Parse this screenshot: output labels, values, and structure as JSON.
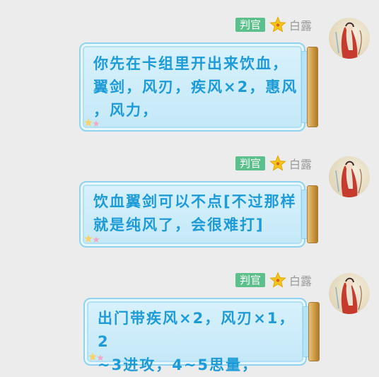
{
  "messages": [
    {
      "role": "判官",
      "name": "白露",
      "text": "你先在卡组里开出来饮血，\n翼剑，风刃，疾风×2，惠风\n，风力，"
    },
    {
      "role": "判官",
      "name": "白露",
      "text": "饮血翼剑可以不点[不过那样\n就是纯风了，会很难打]"
    },
    {
      "role": "判官",
      "name": "白露",
      "text": "出门带疾风×2，风刃×1，2\n~3进攻，4~5思量，"
    }
  ],
  "colors": {
    "badge": "#5cc08c",
    "username": "#9a9a9a",
    "bubble_text": "#1d9bd8",
    "bubble_border": "#8fd3f1",
    "background": "#ececec"
  },
  "icons": {
    "rank": "star-icon",
    "bubble_decoration": "corner-stars-icon"
  }
}
